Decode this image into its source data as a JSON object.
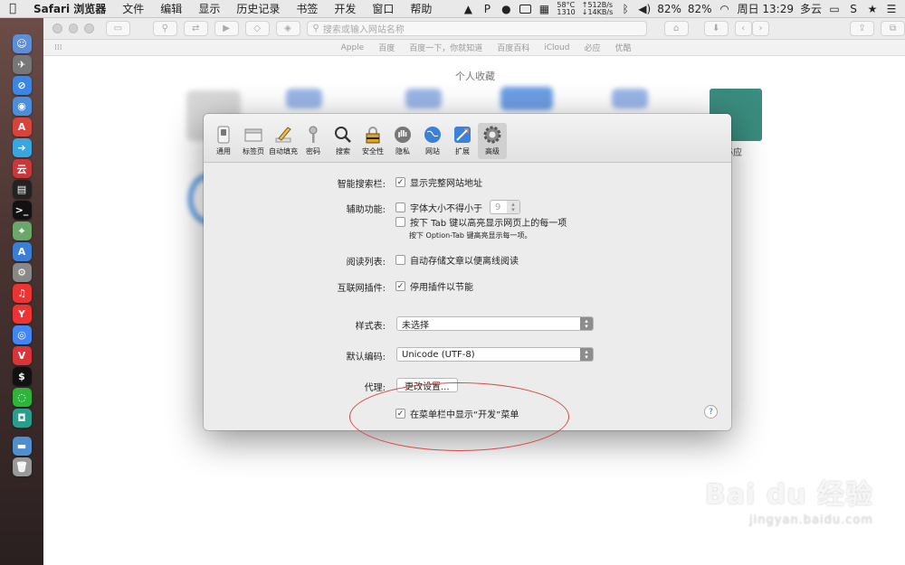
{
  "menubar": {
    "apple_icon": "apple-logo",
    "items": [
      "Safari 浏览器",
      "文件",
      "编辑",
      "显示",
      "历史记录",
      "书签",
      "开发",
      "窗口",
      "帮助"
    ],
    "status": {
      "cpu_temp": "58°C",
      "fan": "1310",
      "net_up": "↑512B/s",
      "net_down": "↓14KB/s",
      "battery1": "82%",
      "battery2": "82%",
      "datetime": "周日 13:29",
      "weather": "多云"
    }
  },
  "safari": {
    "address_placeholder": "搜索或输入网站名称",
    "favorites": [
      "Apple",
      "百度",
      "百度一下，你就知道",
      "百度百科",
      "iCloud",
      "必应",
      "优酷"
    ],
    "topsites_title": "个人收藏",
    "topsite_label": "必应"
  },
  "prefs": {
    "tabs": [
      {
        "label": "通用",
        "icon": "switch-icon"
      },
      {
        "label": "标签页",
        "icon": "tabs-icon"
      },
      {
        "label": "自动填充",
        "icon": "pencil-icon"
      },
      {
        "label": "密码",
        "icon": "key-icon"
      },
      {
        "label": "搜索",
        "icon": "magnifier-icon"
      },
      {
        "label": "安全性",
        "icon": "lock-icon"
      },
      {
        "label": "隐私",
        "icon": "hand-icon"
      },
      {
        "label": "网站",
        "icon": "globe-icon"
      },
      {
        "label": "扩展",
        "icon": "puzzle-icon"
      },
      {
        "label": "高级",
        "icon": "gear-icon"
      }
    ],
    "selected_tab": "高级",
    "smart_search_label": "智能搜索栏:",
    "smart_search_option": "显示完整网站地址",
    "accessibility_label": "辅助功能:",
    "min_font_option": "字体大小不得小于",
    "min_font_value": "9",
    "tab_highlight_option": "按下 Tab 键以高亮显示网页上的每一项",
    "tab_highlight_note": "按下 Option-Tab 键高亮显示每一项。",
    "reading_list_label": "阅读列表:",
    "reading_list_option": "自动存储文章以便离线阅读",
    "plugins_label": "互联网插件:",
    "plugins_option": "停用插件以节能",
    "stylesheet_label": "样式表:",
    "stylesheet_value": "未选择",
    "encoding_label": "默认编码:",
    "encoding_value": "Unicode (UTF-8)",
    "proxy_label": "代理:",
    "proxy_button": "更改设置...",
    "develop_menu_option": "在菜单栏中显示“开发”菜单",
    "help_label": "?"
  },
  "watermark": {
    "brand": "Bai du 经验",
    "url": "jingyan.baidu.com"
  }
}
